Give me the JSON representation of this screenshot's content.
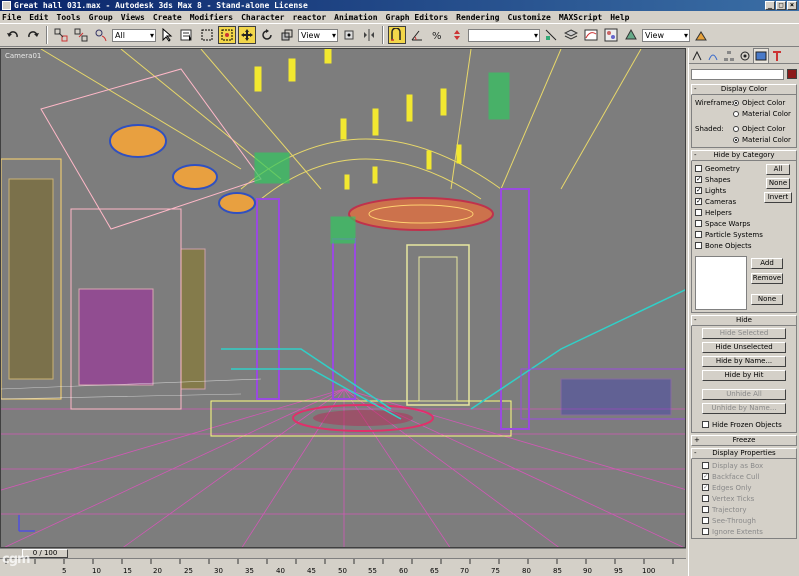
{
  "window": {
    "title": "Great hall 031.max  -  Autodesk 3ds Max 8  -  Stand-alone License",
    "controls": [
      "_",
      "□",
      "×"
    ]
  },
  "menu": [
    "File",
    "Edit",
    "Tools",
    "Group",
    "Views",
    "Create",
    "Modifiers",
    "Character",
    "reactor",
    "Animation",
    "Graph Editors",
    "Rendering",
    "Customize",
    "MAXScript",
    "Help"
  ],
  "toolbar": {
    "selection_filter": "All",
    "ref_coord": "View",
    "named_selection": "",
    "right_view_select": "View",
    "icons": [
      "undo-icon",
      "redo-icon",
      "link-icon",
      "unlink-icon",
      "bind-space-warp-icon",
      "select-icon",
      "select-by-name-icon",
      "rect-region-icon",
      "window-crossing-icon",
      "move-icon",
      "rotate-icon",
      "scale-icon",
      "pivot-icon",
      "mirror-icon",
      "snap-icon",
      "angle-snap-icon",
      "percent-snap-icon",
      "spinner-snap-icon",
      "align-icon",
      "layer-icon",
      "curve-editor-icon",
      "material-editor-icon",
      "render-scene-icon",
      "quick-render-icon"
    ]
  },
  "viewport": {
    "label": "Camera01"
  },
  "command_panel": {
    "tabs": [
      "create-tab-icon",
      "modify-tab-icon",
      "hierarchy-tab-icon",
      "motion-tab-icon",
      "display-tab-icon",
      "utilities-tab-icon"
    ],
    "swatch_color": "#8b1a1a",
    "display_color": {
      "header": "Display Color",
      "wireframe_label": "Wireframe:",
      "shaded_label": "Shaded:",
      "object_color": "Object Color",
      "material_color": "Material Color"
    },
    "hide_by_category": {
      "header": "Hide by Category",
      "categories": [
        {
          "label": "Geometry",
          "checked": false
        },
        {
          "label": "Shapes",
          "checked": true
        },
        {
          "label": "Lights",
          "checked": true
        },
        {
          "label": "Cameras",
          "checked": true
        },
        {
          "label": "Helpers",
          "checked": false
        },
        {
          "label": "Space Warps",
          "checked": false
        },
        {
          "label": "Particle Systems",
          "checked": false
        },
        {
          "label": "Bone Objects",
          "checked": false
        }
      ],
      "all": "All",
      "none": "None",
      "invert": "Invert",
      "add": "Add",
      "remove": "Remove",
      "none2": "None"
    },
    "hide": {
      "header": "Hide",
      "hide_selected": "Hide Selected",
      "hide_unselected": "Hide Unselected",
      "hide_by_name": "Hide by Name...",
      "hide_by_hit": "Hide by Hit",
      "unhide_all": "Unhide All",
      "unhide_by_name": "Unhide by Name...",
      "hide_frozen": "Hide Frozen Objects"
    },
    "freeze": {
      "header": "Freeze"
    },
    "display_properties": {
      "header": "Display Properties",
      "items": [
        {
          "label": "Display as Box",
          "checked": false
        },
        {
          "label": "Backface Cull",
          "checked": true
        },
        {
          "label": "Edges Only",
          "checked": true
        },
        {
          "label": "Vertex Ticks",
          "checked": false
        },
        {
          "label": "Trajectory",
          "checked": false
        },
        {
          "label": "See-Through",
          "checked": false
        },
        {
          "label": "Ignore Extents",
          "checked": false
        }
      ]
    }
  },
  "timeline": {
    "frame_indicator": "0 / 100",
    "ticks": [
      "5",
      "10",
      "15",
      "20",
      "25",
      "30",
      "35",
      "40",
      "45",
      "50",
      "55",
      "60",
      "65",
      "70",
      "75",
      "80",
      "85",
      "90",
      "95",
      "100"
    ]
  },
  "watermark": "cgm"
}
